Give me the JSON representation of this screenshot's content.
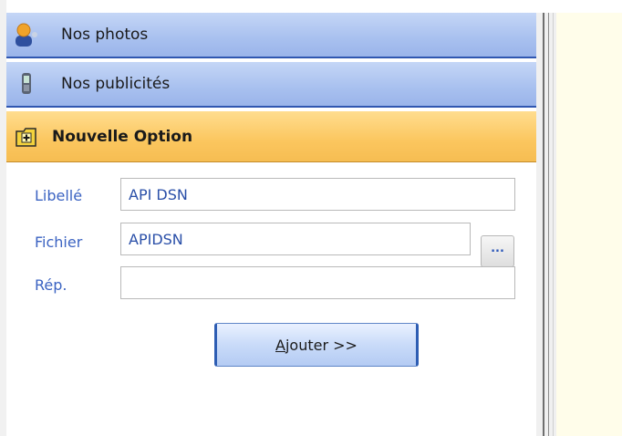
{
  "nav": {
    "photos_label": "Nos photos",
    "ads_label": "Nos publicités",
    "new_option_label": "Nouvelle Option"
  },
  "form": {
    "label_libelle": "Libellé",
    "label_fichier": "Fichier",
    "label_rep": "Rép.",
    "libelle_value": "API DSN",
    "fichier_value": "APIDSN",
    "rep_value": "",
    "browse_label": "...",
    "add_button_first": "A",
    "add_button_rest": "jouter >>"
  },
  "colors": {
    "nav_blue": "#a8c0ef",
    "nav_active": "#fbc65e",
    "label_blue": "#3b63c2",
    "right_pane": "#fffdea"
  }
}
